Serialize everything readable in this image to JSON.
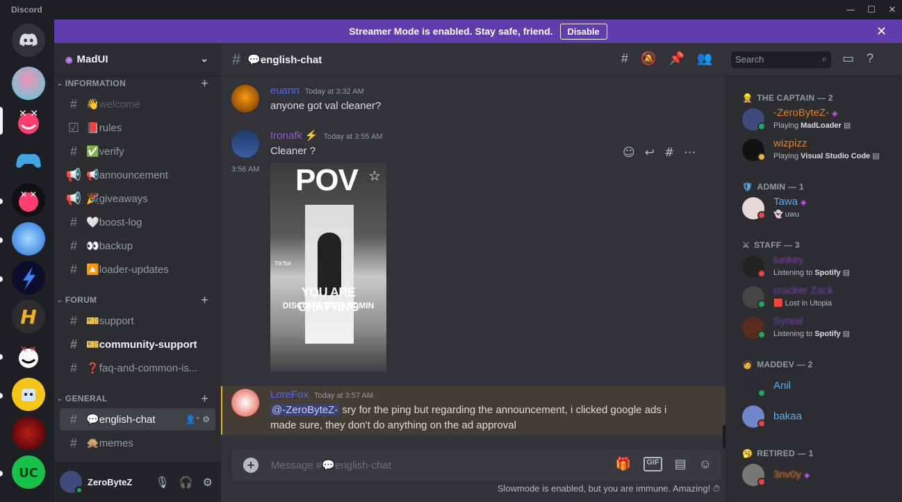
{
  "app_title": "Discord",
  "window_controls": {
    "min": "—",
    "max": "☐",
    "close": "✕"
  },
  "banner": {
    "text": "Streamer Mode is enabled. Stay safe, friend.",
    "button": "Disable",
    "close": "✕"
  },
  "server": {
    "name": "MadUI"
  },
  "categories": {
    "information": "INFORMATION",
    "forum": "FORUM",
    "general": "GENERAL"
  },
  "channels": [
    {
      "icon": "#",
      "emoji": "👋",
      "name": "welcome"
    },
    {
      "icon": "☑",
      "emoji": "📕",
      "name": "rules"
    },
    {
      "icon": "#",
      "emoji": "✅",
      "name": "verify"
    },
    {
      "icon": "📢",
      "emoji": "📢",
      "name": "announcement"
    },
    {
      "icon": "📢",
      "emoji": "🎉",
      "name": "giveaways"
    },
    {
      "icon": "#",
      "emoji": "🤍",
      "name": "boost-log"
    },
    {
      "icon": "#",
      "emoji": "👀",
      "name": "backup"
    },
    {
      "icon": "#",
      "emoji": "🔼",
      "name": "loader-updates"
    },
    {
      "icon": "#",
      "emoji": "🎫",
      "name": "support"
    },
    {
      "icon": "#",
      "emoji": "🎫",
      "name": "community-support"
    },
    {
      "icon": "#",
      "emoji": "❓",
      "name": "faq-and-common-is..."
    },
    {
      "icon": "#",
      "emoji": "💬",
      "name": "english-chat"
    },
    {
      "icon": "#",
      "emoji": "🙊",
      "name": "memes"
    }
  ],
  "user": {
    "name": "ZeroByteZ"
  },
  "channel_header": {
    "title": "💬english-chat",
    "search_placeholder": "Search"
  },
  "messages": [
    {
      "author": "euann",
      "author_color": "#5865f2",
      "time": "Today at 3:32 AM",
      "text": "anyone got val cleaner?"
    },
    {
      "author": "Ironafk",
      "author_color": "#9b59d0",
      "badge": "⚡",
      "time": "Today at 3:55 AM",
      "text": "Cleaner ?"
    },
    {
      "side_time": "3:56 AM",
      "image_top": "POV",
      "image_bottom_1": "YOU ARE CHATTING",
      "image_bottom_2": "DISCORD WITH ADMIN",
      "image_watermark": "TikTok"
    },
    {
      "author": "LoreFox",
      "author_color": "#5865f2",
      "time": "Today at 3:57 AM",
      "mention": "@-ZeroByteZ-",
      "text_1": " sry for the ping but regarding the announcement, i clicked google ads i",
      "text_2": "made sure, they don't do anything on the ad approval"
    }
  ],
  "composer": {
    "placeholder": "Message #💬english-chat"
  },
  "slowmode": "Slowmode is enabled, but you are immune. Amazing!",
  "member_groups": [
    {
      "title": "THE CAPTAIN — 2",
      "icon": "👷"
    },
    {
      "title": "ADMIN — 1",
      "icon": "🛡"
    },
    {
      "title": "STAFF — 3",
      "icon": "⚔"
    },
    {
      "title": "MADDEV — 2",
      "icon": "🧑"
    },
    {
      "title": "RETIRED — 1",
      "icon": "🥱"
    }
  ],
  "members": [
    {
      "name": "-ZeroByteZ-",
      "color": "#e67e22",
      "gem": "◈",
      "activity_prefix": "Playing ",
      "activity": "MadLoader",
      "status": "#23a55a"
    },
    {
      "name": "wizpizz",
      "color": "#e67e22",
      "activity_prefix": "Playing ",
      "activity": "Visual Studio Code",
      "status": "#f0b232"
    },
    {
      "name": "Tawa",
      "color": "#5dadec",
      "gem": "◈",
      "activity_prefix": "👻 ",
      "activity": "uwu",
      "status": "#f23f43"
    },
    {
      "name": "lunkey",
      "color": "#7d3fb0",
      "activity_prefix": "Listening to ",
      "activity": "Spotify",
      "status": "#f23f43"
    },
    {
      "name": "cracker Zack",
      "color": "#7d3fb0",
      "activity_prefix": "🟥 ",
      "activity": "Lost in Utopia",
      "status": "#23a55a"
    },
    {
      "name": "Syreal",
      "color": "#7d3fb0",
      "activity_prefix": "Listening to ",
      "activity": "Spotify",
      "status": "#23a55a"
    },
    {
      "name": "Anil",
      "color": "#5dadec",
      "status": "#23a55a"
    },
    {
      "name": "bakaa",
      "color": "#5dadec",
      "status": "#f23f43"
    },
    {
      "name": "3nv0y",
      "color": "#e67e22",
      "gem": "◈",
      "status": "#f23f43"
    }
  ],
  "colors": {
    "banner": "#5f3dad",
    "accent": "#5865f2",
    "highlight": "#433d34"
  }
}
